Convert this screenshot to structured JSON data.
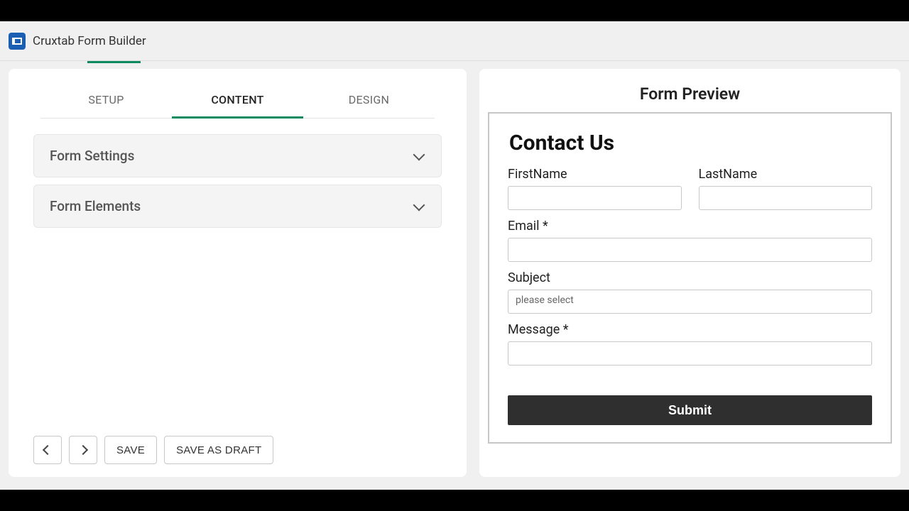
{
  "app": {
    "title": "Cruxtab Form Builder"
  },
  "tabs": {
    "setup": {
      "label": "SETUP"
    },
    "content": {
      "label": "CONTENT"
    },
    "design": {
      "label": "DESIGN"
    }
  },
  "accordion": {
    "settings": "Form Settings",
    "elements": "Form Elements"
  },
  "actions": {
    "save": "SAVE",
    "save_draft": "SAVE AS DRAFT"
  },
  "preview": {
    "title": "Form Preview",
    "form_heading": "Contact Us",
    "fields": {
      "first_name": "FirstName",
      "last_name": "LastName",
      "email": "Email *",
      "subject": "Subject",
      "subject_placeholder": "please select",
      "message": "Message *"
    },
    "submit": "Submit"
  }
}
